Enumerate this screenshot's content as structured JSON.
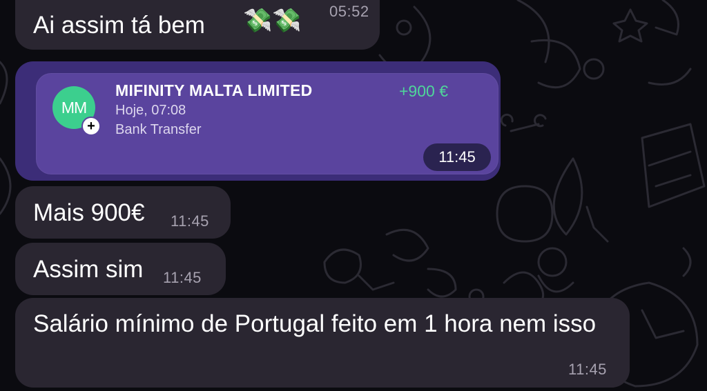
{
  "messages": [
    {
      "text": "Ai assim tá bem",
      "emoji": "💸💸",
      "time": "05:52"
    },
    {
      "text": "Mais 900€",
      "time": "11:45"
    },
    {
      "text": "Assim sim",
      "time": "11:45"
    },
    {
      "text": "Salário mínimo de Portugal feito em 1 hora nem isso",
      "time": "11:45"
    }
  ],
  "transaction_card": {
    "avatar_initials": "MM",
    "badge_glyph": "+",
    "merchant": "MIFINITY MALTA LIMITED",
    "date": "Hoje, 07:08",
    "method": "Bank Transfer",
    "amount": "+900 €",
    "time": "11:45",
    "colors": {
      "card_bg": "#5a449e",
      "outer_bg": "#3c2d78",
      "amount": "#4fd69a",
      "avatar": "#3ccf8e"
    }
  },
  "theme": {
    "background": "#0b0b10",
    "bubble": "#2a2631",
    "time_text": "#a7a2b0"
  }
}
